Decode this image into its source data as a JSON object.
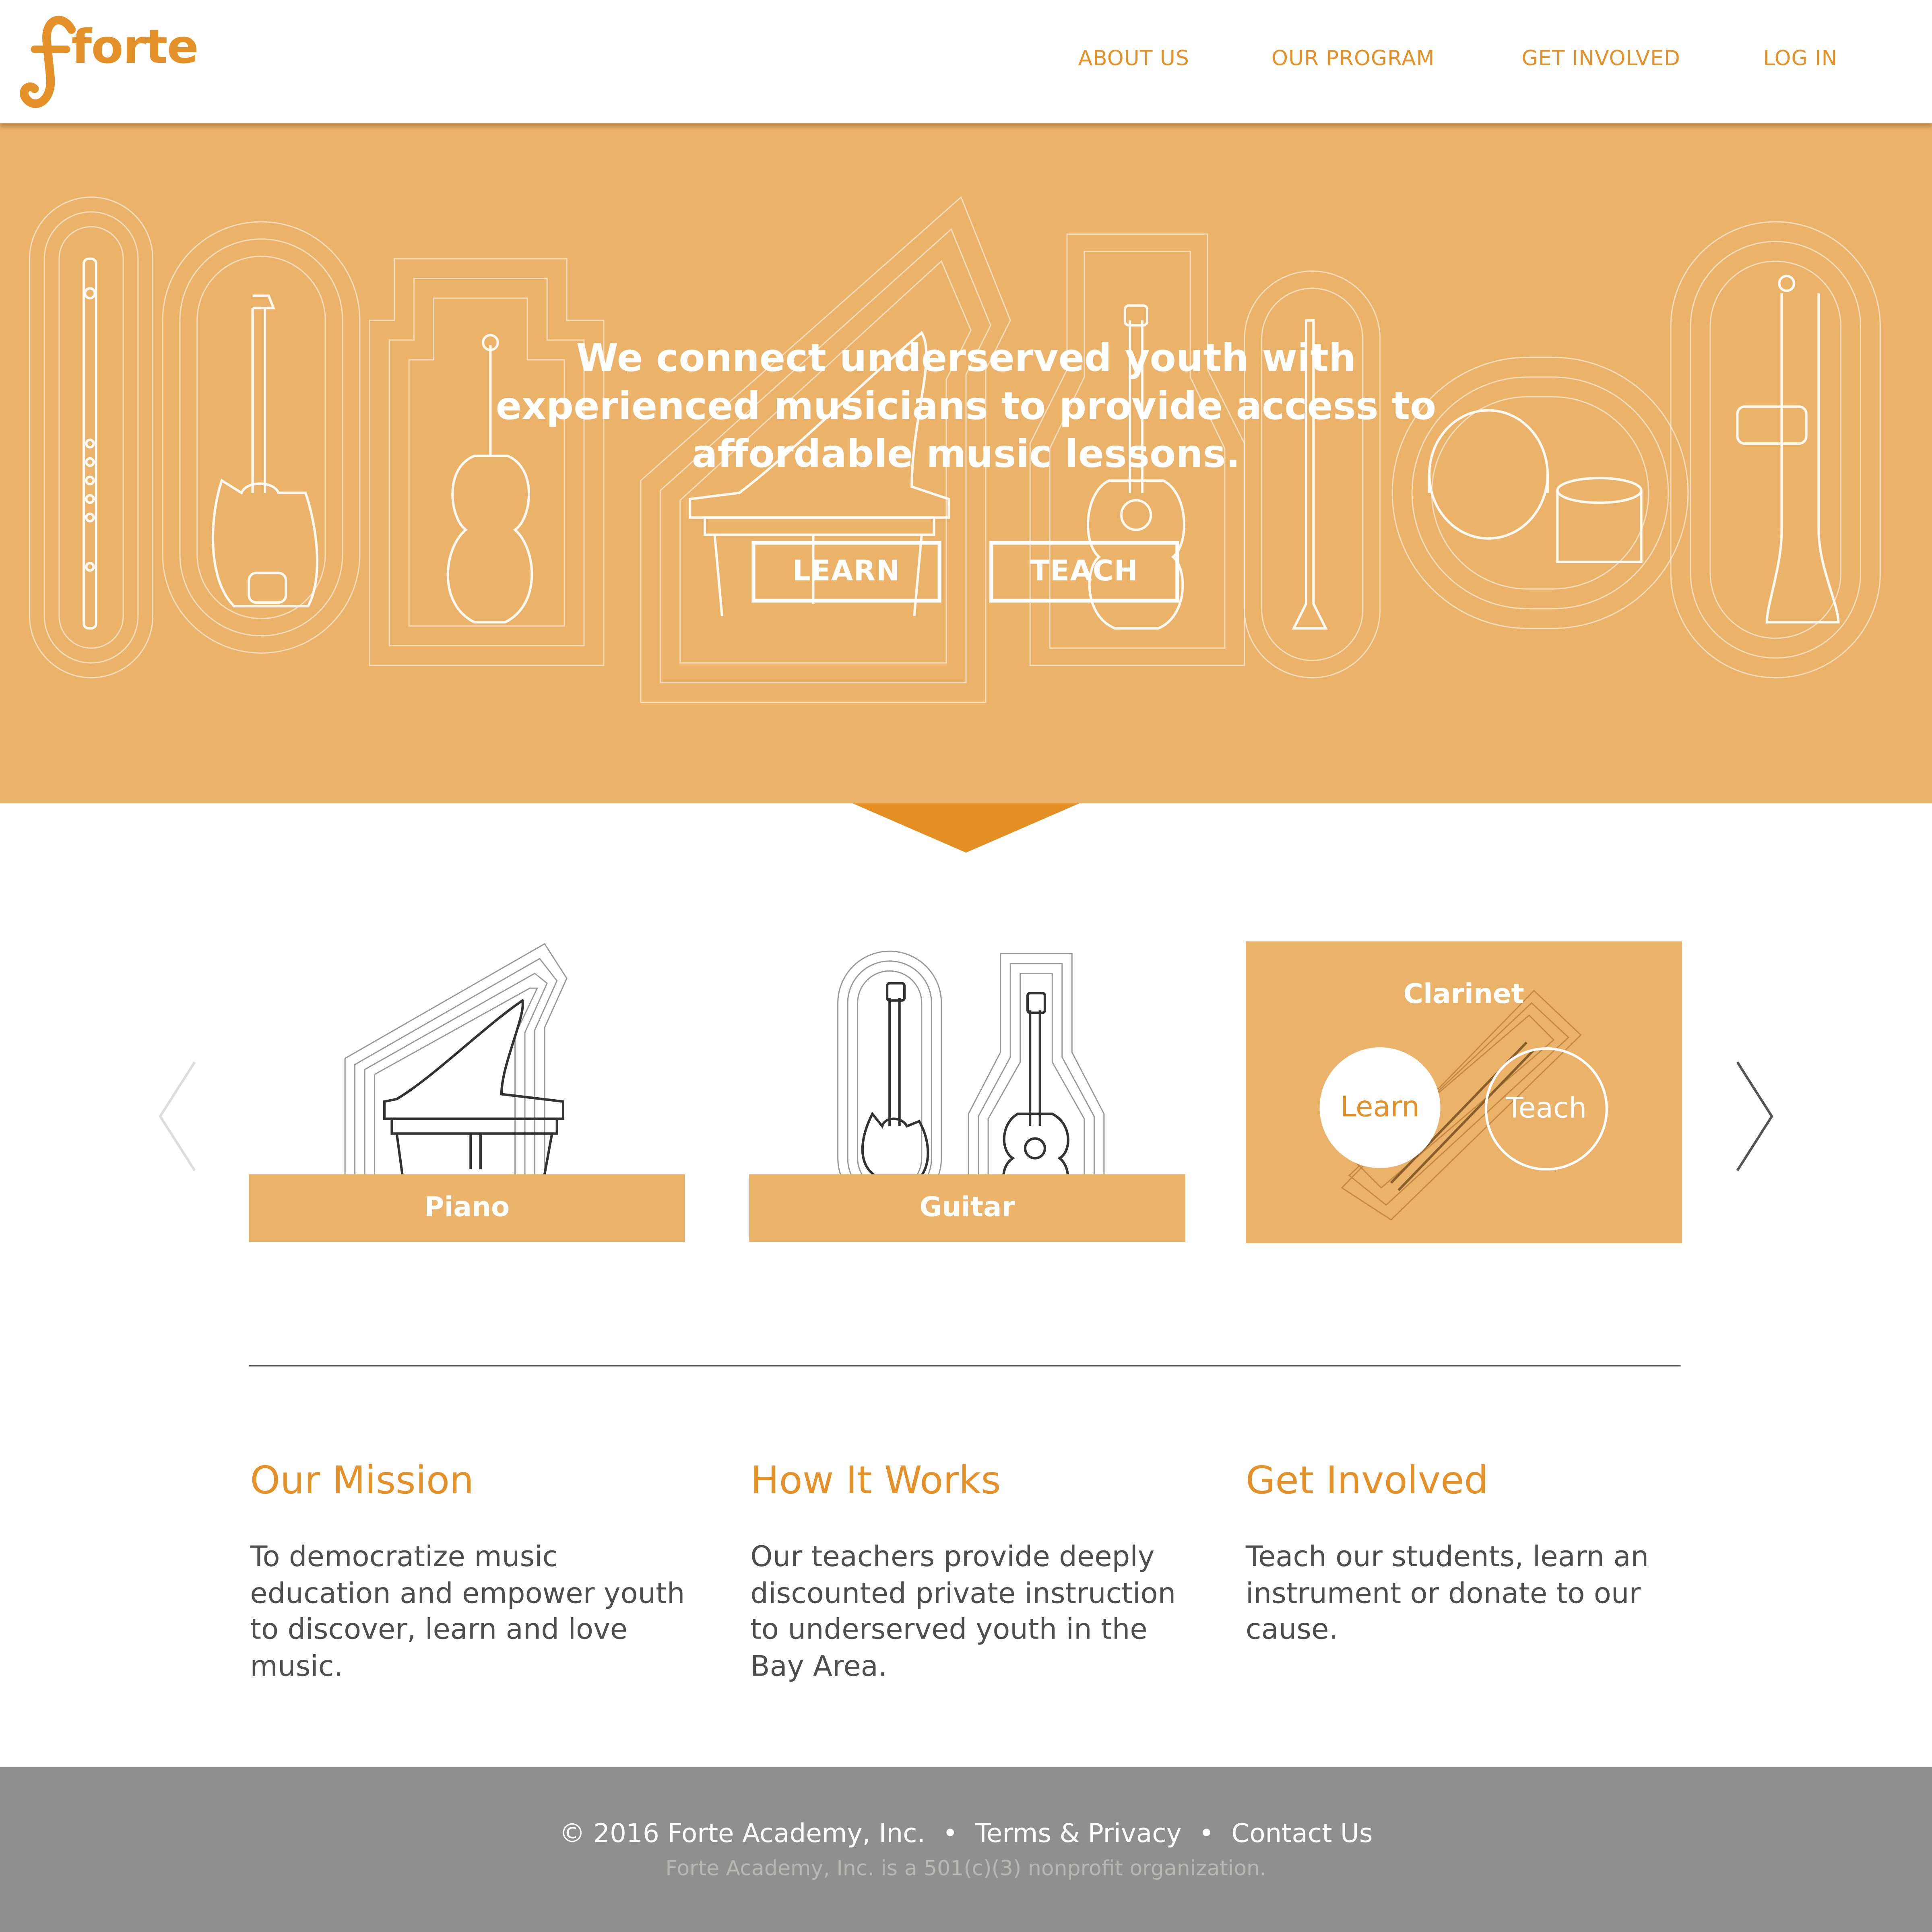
{
  "brand": {
    "logo_text": "forte",
    "color": "#e39128"
  },
  "nav": {
    "items": [
      {
        "label": "ABOUT US"
      },
      {
        "label": "OUR PROGRAM"
      },
      {
        "label": "GET INVOLVED"
      },
      {
        "label": "LOG IN"
      }
    ]
  },
  "hero": {
    "headline_lines": [
      "We connect underserved youth with",
      "experienced musicians to provide access to",
      "affordable music lessons."
    ],
    "learn_button": "LEARN",
    "teach_button": "TEACH",
    "background_color": "#ebb26a",
    "accent_color": "#e48f24"
  },
  "carousel": {
    "prev_icon": "chevron-left-icon",
    "next_icon": "chevron-right-icon",
    "cards": [
      {
        "label": "Piano",
        "icon": "piano-icon"
      },
      {
        "label": "Guitar",
        "icon": "guitar-icon"
      },
      {
        "label": "Clarinet",
        "icon": "clarinet-icon",
        "learn_label": "Learn",
        "teach_label": "Teach"
      }
    ]
  },
  "info": {
    "columns": [
      {
        "title": "Our Mission",
        "body": "To democratize music education and empower youth to discover, learn and love music."
      },
      {
        "title": "How It Works",
        "body": "Our teachers provide deeply discounted private instruction to underserved youth in the Bay Area."
      },
      {
        "title": "Get Involved",
        "body": "Teach our students, learn an instrument or donate to our cause."
      }
    ]
  },
  "footer": {
    "copyright": "© 2016 Forte Academy, Inc.",
    "separator": "•",
    "terms": "Terms & Privacy",
    "contact": "Contact Us",
    "note": "Forte Academy, Inc. is a 501(c)(3) nonprofit organization.",
    "background_color": "#8e8f8e"
  }
}
